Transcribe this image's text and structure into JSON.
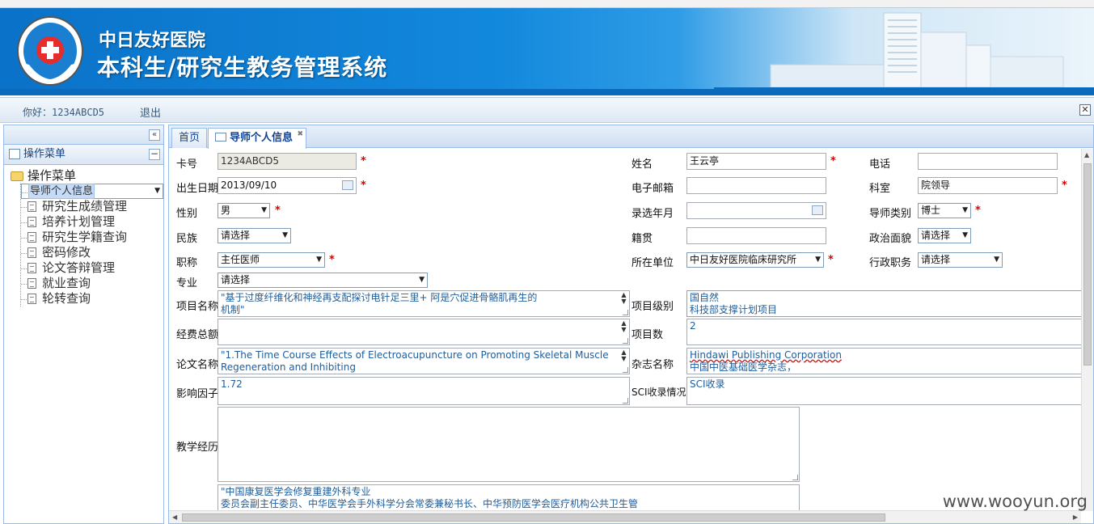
{
  "app": {
    "hospital_name": "中日友好医院",
    "system_name": "本科生/研究生教务管理系统",
    "greeting": "你好：1234ABCD5",
    "logout": "退出"
  },
  "sidebar": {
    "panel_title": "操作菜单",
    "root_label": "操作菜单",
    "items": [
      {
        "label": "导师个人信息",
        "selected": true
      },
      {
        "label": "研究生成绩管理"
      },
      {
        "label": "培养计划管理"
      },
      {
        "label": "研究生学籍查询"
      },
      {
        "label": "密码修改"
      },
      {
        "label": "论文答辩管理"
      },
      {
        "label": "就业查询"
      },
      {
        "label": "轮转查询"
      }
    ]
  },
  "tabs": [
    {
      "label": "首页"
    },
    {
      "label": "导师个人信息",
      "active": true
    }
  ],
  "form": {
    "card_no": {
      "label": "卡号",
      "value": "1234ABCD5"
    },
    "name": {
      "label": "姓名",
      "value": "王云亭"
    },
    "phone": {
      "label": "电话",
      "value": ""
    },
    "birth": {
      "label": "出生日期",
      "value": "2013/09/10"
    },
    "email": {
      "label": "电子邮箱",
      "value": ""
    },
    "dept": {
      "label": "科室",
      "value": "院领导"
    },
    "gender": {
      "label": "性别",
      "value": "男"
    },
    "year": {
      "label": "录选年月",
      "value": ""
    },
    "tutor_type": {
      "label": "导师类别",
      "value": "博士"
    },
    "nation": {
      "label": "民族",
      "value": "请选择"
    },
    "native": {
      "label": "籍贯",
      "value": ""
    },
    "politics": {
      "label": "政治面貌",
      "value": "请选择"
    },
    "title": {
      "label": "职称",
      "value": "主任医师"
    },
    "unit": {
      "label": "所在单位",
      "value": "中日友好医院临床研究所"
    },
    "admin_post": {
      "label": "行政职务",
      "value": "请选择"
    },
    "major": {
      "label": "专业",
      "value": "请选择"
    },
    "project_name": {
      "label": "项目名称",
      "line1": "\"基于过度纤维化和神经再支配探讨电针足三里+ 阿是穴促进骨骼肌再生的",
      "line2": "机制\""
    },
    "project_level": {
      "label": "项目级别",
      "line1": "国自然",
      "line2": "科技部支撑计划项目"
    },
    "funding": {
      "label": "经费总额",
      "value": ""
    },
    "project_count": {
      "label": "项目数",
      "value": "2"
    },
    "paper": {
      "label": "论文名称",
      "line1": "\"1.The Time Course Effects of Electroacupuncture on Promoting  Skeletal Muscle",
      "line2": "Regeneration and Inhibiting"
    },
    "journal": {
      "label": "杂志名称",
      "line1": "Hindawi Publishing Corporation",
      "line2": "中国中医基础医学杂志，"
    },
    "impact": {
      "label": "影响因子",
      "value": "1.72"
    },
    "sci": {
      "label": "SCI收录情况",
      "value": "SCI收录"
    },
    "teaching": {
      "label": "教学经历",
      "value": ""
    },
    "social": {
      "line1": "\"中国康复医学会修复重建外科专业",
      "line2": "委员会副主任委员、中华医学会手外科学分会常委兼秘书长、中华预防医学会医疗机构公共卫生管"
    }
  },
  "watermark": "www.wooyun.org",
  "colors": {
    "banner": "#0a72c8",
    "panel_border": "#99bbe8",
    "required": "#dd0000",
    "text_blue": "#1f5d9b"
  }
}
